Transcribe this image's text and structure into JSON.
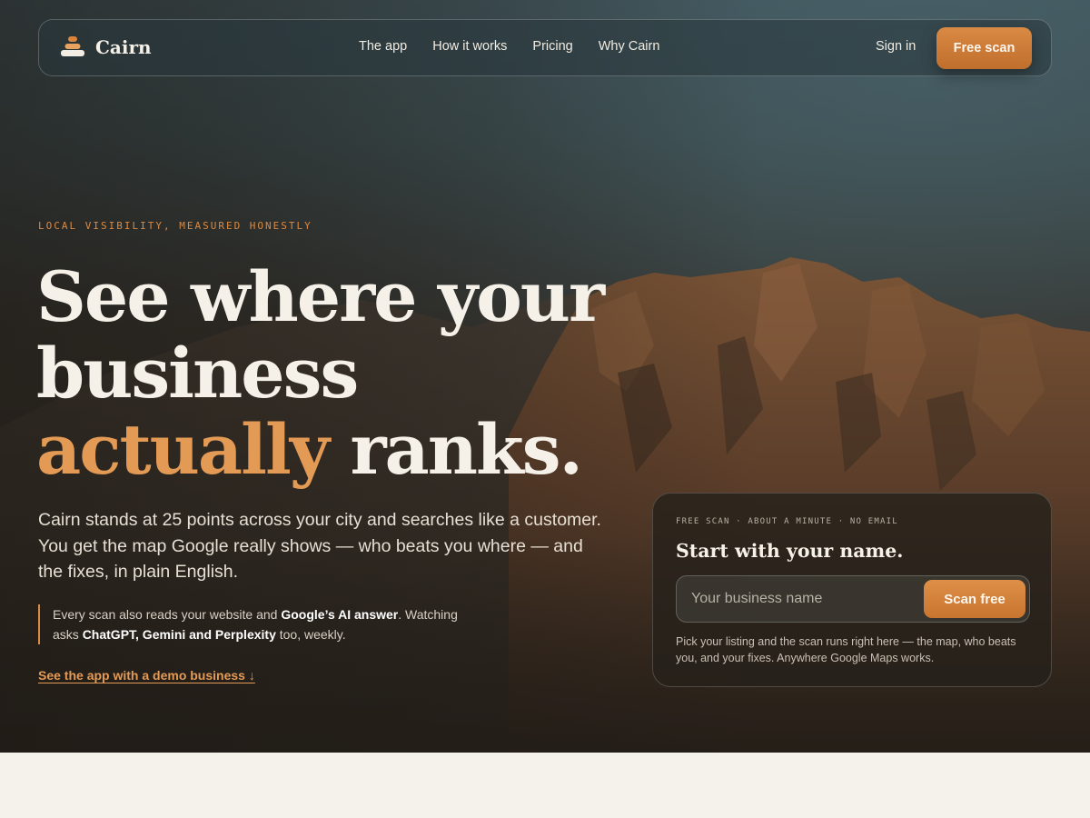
{
  "nav": {
    "brand": "Cairn",
    "links": [
      {
        "label": "The app"
      },
      {
        "label": "How it works"
      },
      {
        "label": "Pricing"
      },
      {
        "label": "Why Cairn"
      }
    ],
    "signin": "Sign in",
    "cta": "Free scan"
  },
  "hero": {
    "eyebrow": "LOCAL VISIBILITY, MEASURED HONESTLY",
    "headline": {
      "line1": "See where your",
      "line2": "business",
      "accent": "actually",
      "rest": " ranks."
    },
    "lede": "Cairn stands at 25 points across your city and searches like a customer. You get the map Google really shows — who beats you where — and the fixes, in plain English.",
    "note": {
      "p1": "Every scan also reads your website and ",
      "b1": "Google’s AI answer",
      "p2": ". Watching asks ",
      "b2": "ChatGPT, Gemini and Perplexity",
      "p3": " too, weekly."
    },
    "demo_link": "See the app with a demo business ↓"
  },
  "scan_card": {
    "meta": "FREE SCAN · ABOUT A MINUTE · NO EMAIL",
    "title": "Start with your name.",
    "input_placeholder": "Your business name",
    "button": "Scan free",
    "help": "Pick your listing and the scan runs right here — the map, who beats you, and your fixes. Anywhere Google Maps works."
  },
  "colors": {
    "accent": "#d98a44",
    "accent_light": "#e39a55",
    "cream": "#f5f2ec"
  }
}
